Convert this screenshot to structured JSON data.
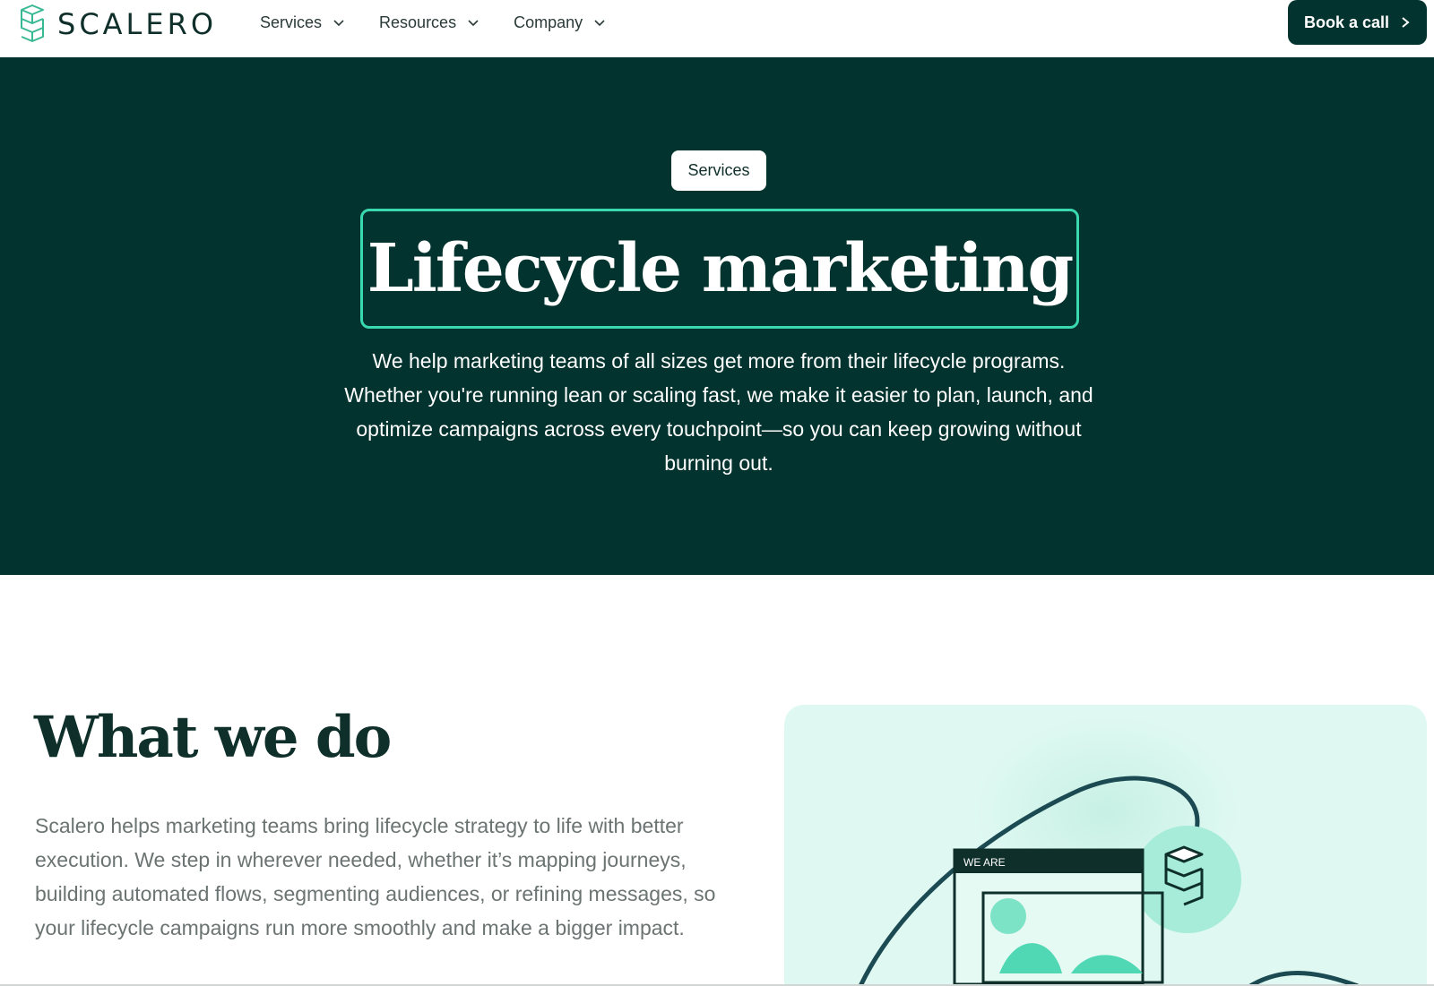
{
  "brand": {
    "name": "SCALERO",
    "accent": "#39d8b1",
    "dark": "#02332e"
  },
  "nav": {
    "items": [
      {
        "label": "Services",
        "icon": "chevron-down-icon"
      },
      {
        "label": "Resources",
        "icon": "chevron-down-icon"
      },
      {
        "label": "Company",
        "icon": "chevron-down-icon"
      }
    ],
    "cta": {
      "label": "Book a call",
      "icon": "chevron-right-icon"
    }
  },
  "hero": {
    "tag": "Services",
    "title": "Lifecycle marketing",
    "description": "We help marketing teams of all sizes get more from their lifecycle programs. Whether you're running lean or scaling fast, we make it easier to plan, launch, and optimize campaigns across every touchpoint—so you can keep growing without burning out."
  },
  "what_we_do": {
    "title": "What we do",
    "description": "Scalero helps marketing teams bring lifecycle strategy to life with better execution. We step in wherever needed, whether it’s mapping journeys, building automated flows, segmenting audiences, or refining messages, so your lifecycle campaigns run more smoothly and make a bigger impact.",
    "illustration_text": "WE ARE"
  }
}
